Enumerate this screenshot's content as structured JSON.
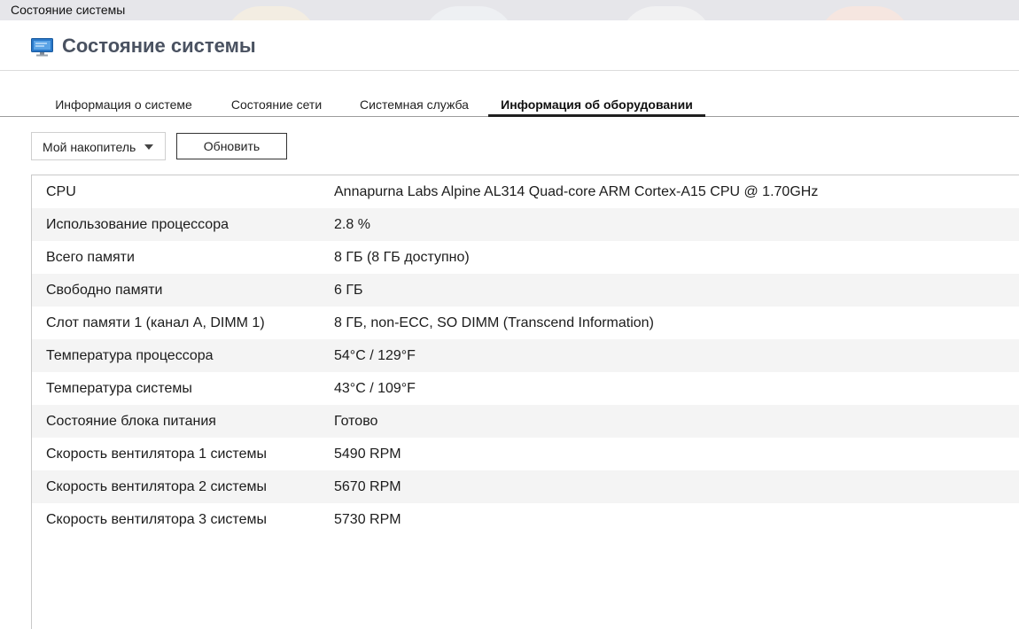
{
  "window": {
    "title": "Состояние системы"
  },
  "header": {
    "title": "Состояние системы",
    "icon": "monitor-icon"
  },
  "tabs": [
    {
      "label": "Информация о системе",
      "active": false
    },
    {
      "label": "Состояние сети",
      "active": false
    },
    {
      "label": "Системная служба",
      "active": false
    },
    {
      "label": "Информация об оборудовании",
      "active": true
    }
  ],
  "toolbar": {
    "device_selected": "Мой накопитель",
    "refresh_label": "Обновить"
  },
  "hardware": [
    {
      "key": "CPU",
      "value": "Annapurna Labs Alpine AL314 Quad-core ARM Cortex-A15 CPU @ 1.70GHz"
    },
    {
      "key": "Использование процессора",
      "value": "2.8 %"
    },
    {
      "key": "Всего памяти",
      "value": "8 ГБ (8 ГБ доступно)"
    },
    {
      "key": "Свободно памяти",
      "value": "6 ГБ"
    },
    {
      "key": "Слот памяти 1 (канал A, DIMM 1)",
      "value": "8 ГБ, non-ECC, SO DIMM (Transcend Information)"
    },
    {
      "key": "Температура процессора",
      "value": "54°C / 129°F"
    },
    {
      "key": "Температура системы",
      "value": "43°C / 109°F"
    },
    {
      "key": "Состояние блока питания",
      "value": "Готово"
    },
    {
      "key": "Скорость вентилятора 1 системы",
      "value": "5490 RPM"
    },
    {
      "key": "Скорость вентилятора 2 системы",
      "value": "5670 RPM"
    },
    {
      "key": "Скорость вентилятора 3 системы",
      "value": "5730 RPM"
    }
  ],
  "colors": {
    "accent": "#1f1f1f",
    "title": "#4a5261",
    "row_alt": "#f4f4f4",
    "icon_blue": "#2a78c8"
  }
}
